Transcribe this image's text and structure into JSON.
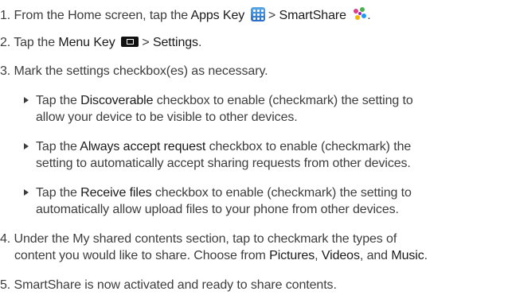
{
  "steps": [
    {
      "num": "1.",
      "pre": "From the Home screen, tap the ",
      "apps_key": "Apps Key",
      "gt": ">",
      "smartshare": "SmartShare",
      "end": "."
    },
    {
      "num": "2.",
      "pre": "Tap the ",
      "menu_key": "Menu Key",
      "gt": ">",
      "settings": "Settings",
      "end": "."
    },
    {
      "num": "3.",
      "text": "Mark the settings checkbox(es) as necessary."
    },
    {
      "num": "4.",
      "line1": "Under the My shared contents section, tap to checkmark the types of",
      "line2_pre": "content you would like to share. Choose from ",
      "pictures": "Pictures",
      "comma": ",",
      "videos": "Videos",
      "and": ", and",
      "music": "Music",
      "end": "."
    },
    {
      "num": "5.",
      "text": "SmartShare is now activated and ready to share contents."
    }
  ],
  "bullets": [
    {
      "pre": "Tap the ",
      "bold": "Discoverable",
      "line1_post": " checkbox to enable (checkmark) the setting to",
      "line2": "allow your device to be visible to other devices."
    },
    {
      "pre": "Tap the ",
      "bold": "Always accept request",
      "line1_post": " checkbox to enable (checkmark) the",
      "line2": "setting to automatically accept sharing requests from other devices."
    },
    {
      "pre": "Tap the ",
      "bold": "Receive files",
      "line1_post": " checkbox to enable (checkmark) the setting to",
      "line2": "automatically allow upload files to your phone from other devices."
    }
  ],
  "icons": {
    "apps": "apps-key-icon",
    "menu": "menu-key-icon",
    "smartshare": "smartshare-icon",
    "bullet": "triangle-bullet-icon"
  },
  "colors": {
    "text": "#3d3d3d",
    "apps_icon": "#3a86d8",
    "menu_icon": "#111111"
  }
}
